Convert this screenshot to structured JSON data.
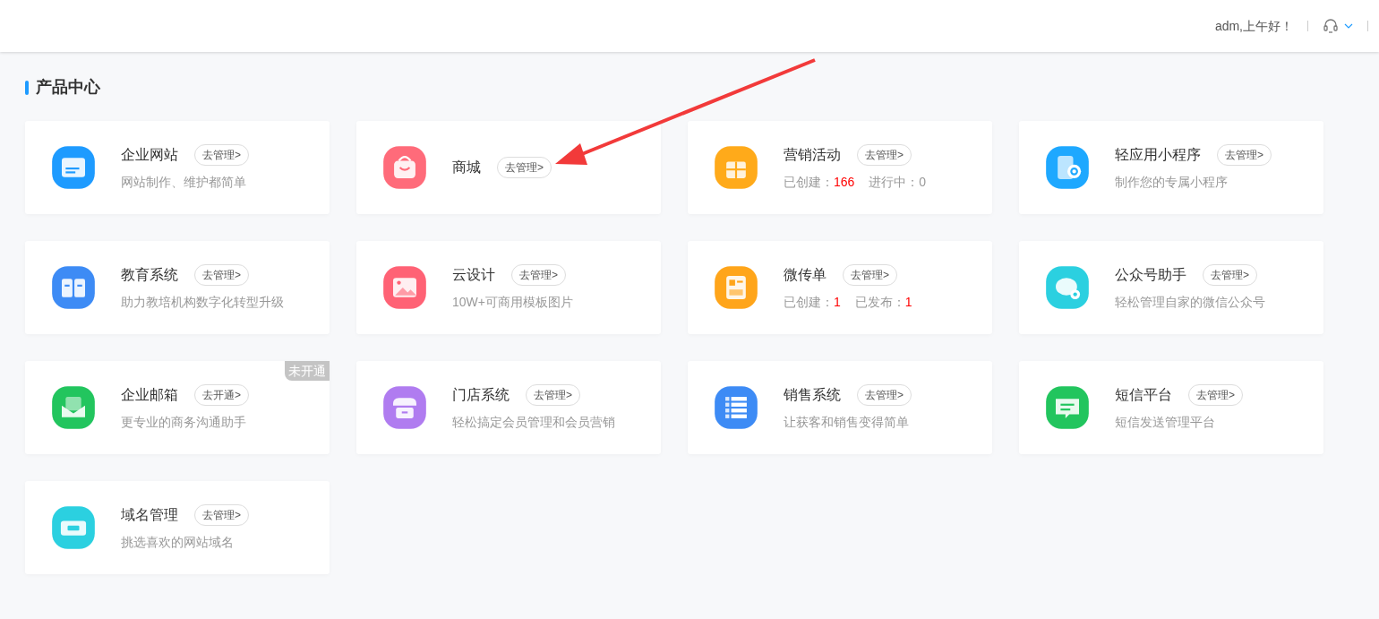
{
  "header": {
    "greeting": "adm,上午好！"
  },
  "section": {
    "title": "产品中心"
  },
  "products": [
    {
      "name": "企业网站",
      "action": "去管理>",
      "color": "#1e9bff",
      "kind": "text",
      "description": "网站制作、维护都简单"
    },
    {
      "name": "商城",
      "action": "去管理>",
      "color": "#ff6b7a",
      "kind": "none"
    },
    {
      "name": "营销活动",
      "action": "去管理>",
      "color": "#ffaa1a",
      "kind": "stats",
      "stats": [
        {
          "label": "已创建：",
          "value": "166",
          "highlight": true
        },
        {
          "label": "进行中：",
          "value": "0",
          "highlight": false
        }
      ]
    },
    {
      "name": "轻应用小程序",
      "action": "去管理>",
      "color": "#1ea8ff",
      "kind": "text",
      "description": "制作您的专属小程序"
    },
    {
      "name": "教育系统",
      "action": "去管理>",
      "color": "#3d8bf5",
      "kind": "text",
      "description": "助力教培机构数字化转型升级"
    },
    {
      "name": "云设计",
      "action": "去管理>",
      "color": "#ff6275",
      "kind": "text",
      "description": "10W+可商用模板图片"
    },
    {
      "name": "微传单",
      "action": "去管理>",
      "color": "#ffa51a",
      "kind": "stats",
      "stats": [
        {
          "label": "已创建：",
          "value": "1",
          "highlight": true
        },
        {
          "label": "已发布：",
          "value": "1",
          "highlight": true
        }
      ]
    },
    {
      "name": "公众号助手",
      "action": "去管理>",
      "color": "#2bd0e0",
      "kind": "text",
      "description": "轻松管理自家的微信公众号"
    },
    {
      "name": "企业邮箱",
      "action": "去开通>",
      "color": "#22c55e",
      "kind": "text",
      "description": "更专业的商务沟通助手",
      "badge": "未开通"
    },
    {
      "name": "门店系统",
      "action": "去管理>",
      "color": "#b07cf0",
      "kind": "text",
      "description": "轻松搞定会员管理和会员营销"
    },
    {
      "name": "销售系统",
      "action": "去管理>",
      "color": "#3d8bf5",
      "kind": "text",
      "description": "让获客和销售变得简单"
    },
    {
      "name": "短信平台",
      "action": "去管理>",
      "color": "#22c55e",
      "kind": "text",
      "description": "短信发送管理平台"
    },
    {
      "name": "域名管理",
      "action": "去管理>",
      "color": "#2bd0e0",
      "kind": "text",
      "description": "挑选喜欢的网站域名"
    }
  ]
}
